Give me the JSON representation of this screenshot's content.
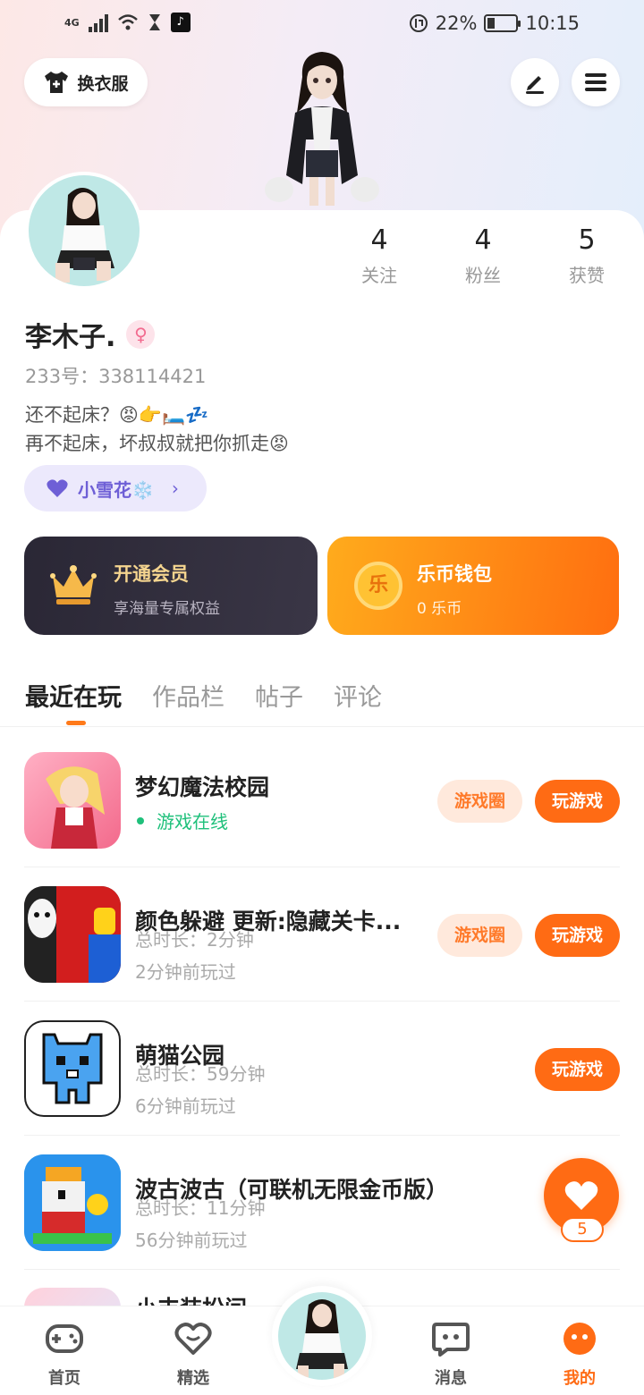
{
  "status_bar": {
    "network": "4G",
    "battery_percent": "22%",
    "time": "10:15"
  },
  "header": {
    "outfit_label": "换衣服"
  },
  "profile": {
    "stats": [
      {
        "num": "4",
        "label": "关注"
      },
      {
        "num": "4",
        "label": "粉丝"
      },
      {
        "num": "5",
        "label": "获赞"
      }
    ],
    "name": "李木子.",
    "gender_symbol": "♀",
    "uid": "233号：338114421",
    "bio_line1": "还不起床？😡👉🛏️💤",
    "bio_line2": "再不起床，坏叔叔就把你抓走😡",
    "fan_pill": "小雪花❄️"
  },
  "cards": {
    "vip_title": "开通会员",
    "vip_sub": "享海量专属权益",
    "wallet_title": "乐币钱包",
    "wallet_sub": "0 乐币",
    "coin_char": "乐"
  },
  "tabs": [
    "最近在玩",
    "作品栏",
    "帖子",
    "评论"
  ],
  "games": [
    {
      "title": "梦幻魔法校园",
      "status": "游戏在线",
      "circle": "游戏圈",
      "play": "玩游戏"
    },
    {
      "title": "颜色躲避 更新:隐藏关卡...",
      "duration": "总时长：2分钟",
      "last": "2分钟前玩过",
      "circle": "游戏圈",
      "play": "玩游戏"
    },
    {
      "title": "萌猫公园",
      "duration": "总时长：59分钟",
      "last": "6分钟前玩过",
      "play": "玩游戏"
    },
    {
      "title": "波古波古（可联机无限金币版）",
      "duration": "总时长：11分钟",
      "last": "56分钟前玩过"
    },
    {
      "title": "小丰装扮间"
    }
  ],
  "float_like_count": "5",
  "nav": [
    "首页",
    "精选",
    "消息",
    "我的"
  ],
  "colors": {
    "accent": "#ff6b14",
    "online": "#1fc07b",
    "fan": "#6e5fd6"
  }
}
